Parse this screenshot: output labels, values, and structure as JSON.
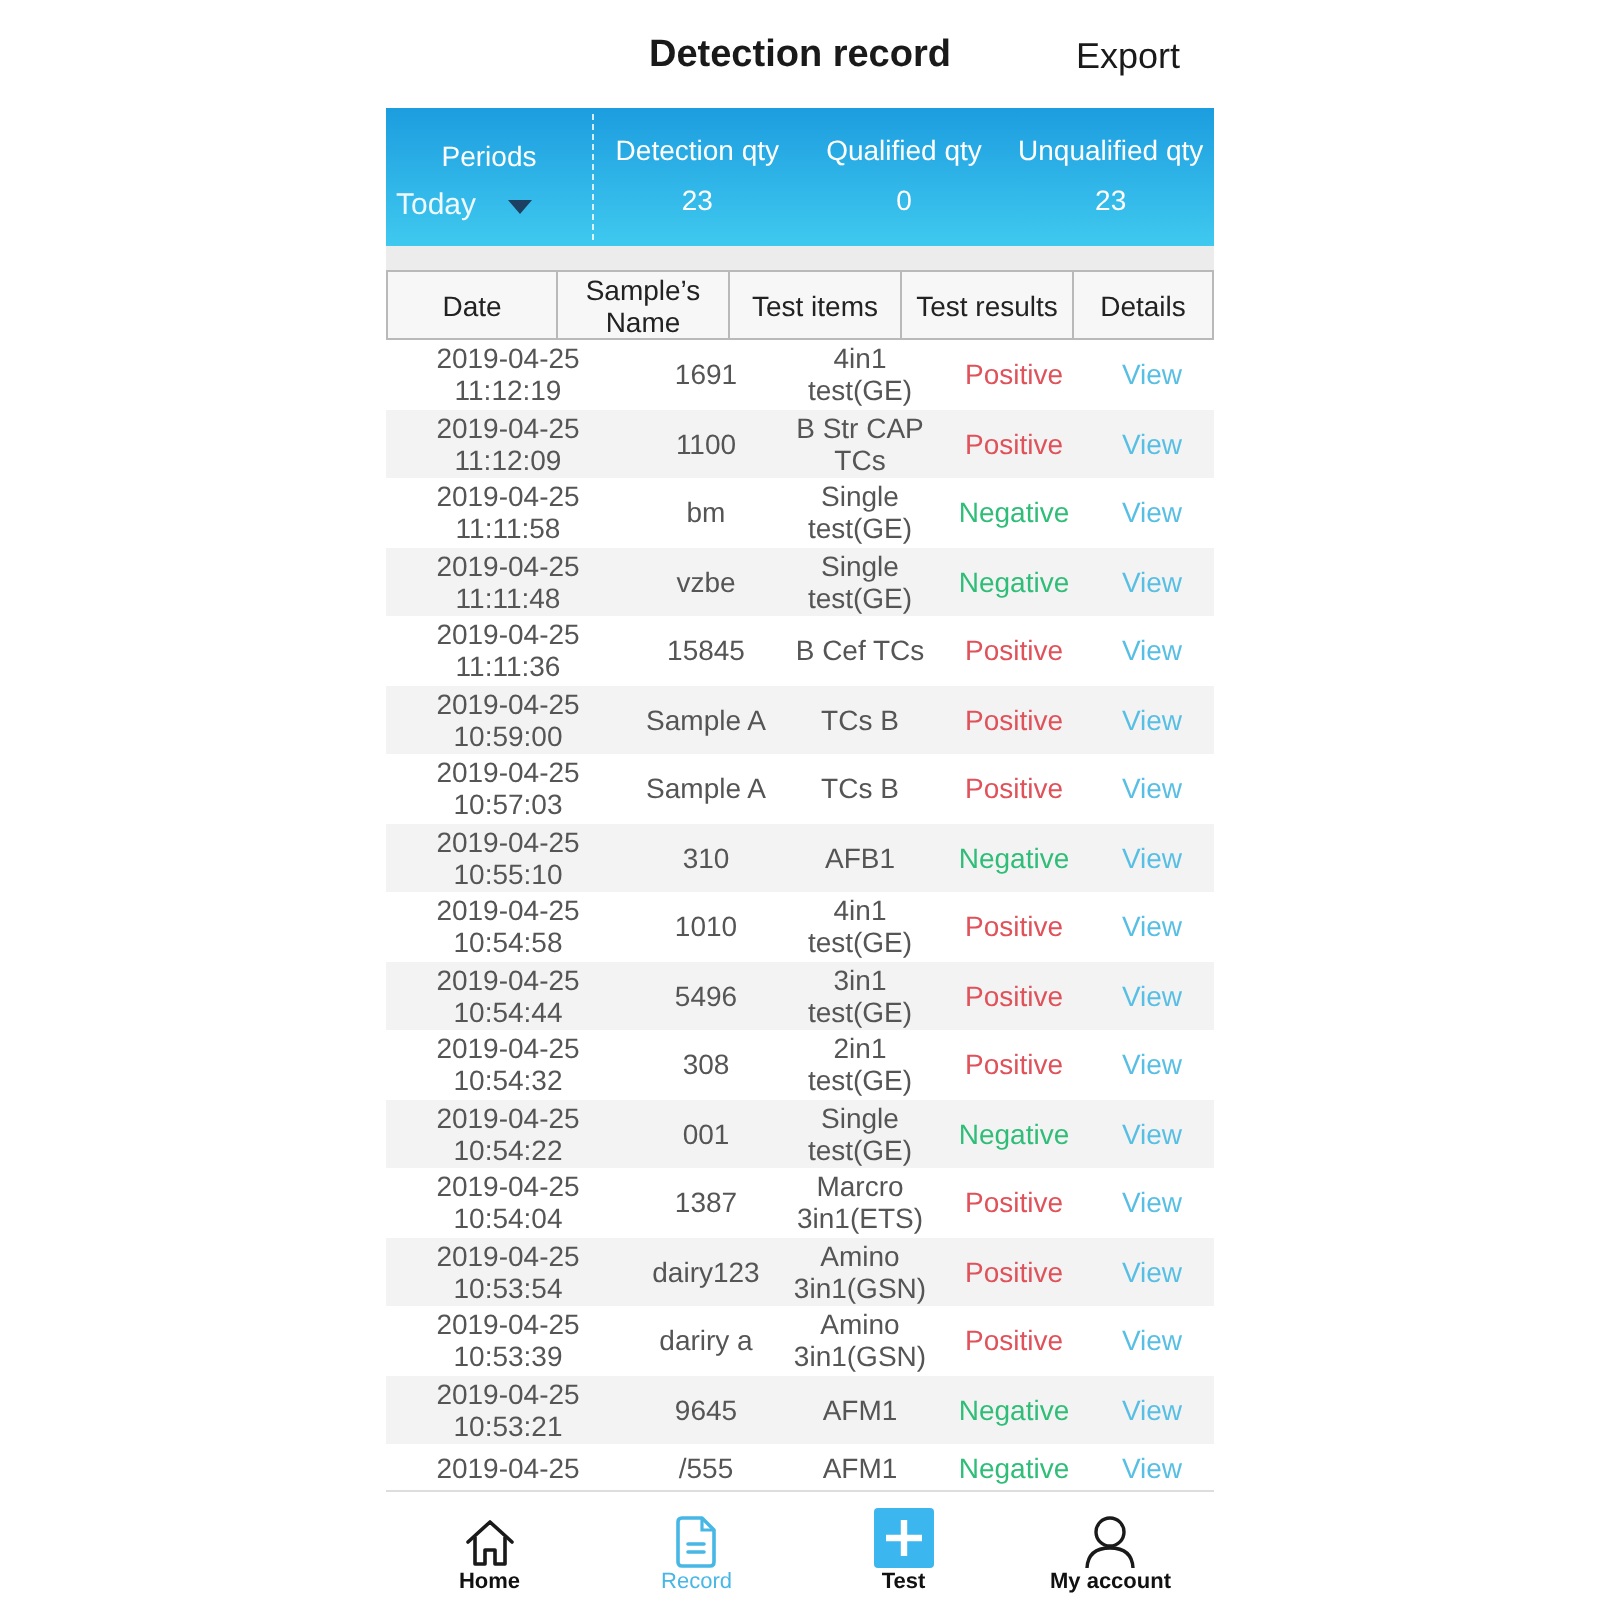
{
  "header": {
    "title": "Detection record",
    "action": "Export"
  },
  "summary": {
    "period_label": "Periods",
    "period_value": "Today",
    "stats": [
      {
        "label": "Detection qty",
        "value": "23"
      },
      {
        "label": "Qualified qty",
        "value": "0"
      },
      {
        "label": "Unqualified qty",
        "value": "23"
      }
    ]
  },
  "table": {
    "columns": [
      "Date",
      "Sample’s Name",
      "Test items",
      "Test results",
      "Details"
    ],
    "rows": [
      {
        "date": "2019-04-25 11:12:19",
        "sample": "1691",
        "item": "4in1 test(GE)",
        "result": "Positive",
        "color": "#e0525a",
        "details": "View"
      },
      {
        "date": "2019-04-25 11:12:09",
        "sample": "1100",
        "item": "B Str CAP TCs",
        "result": "Positive",
        "color": "#e0525a",
        "details": "View"
      },
      {
        "date": "2019-04-25 11:11:58",
        "sample": "bm",
        "item": "Single test(GE)",
        "result": "Negative",
        "color": "#2fbd78",
        "details": "View"
      },
      {
        "date": "2019-04-25 11:11:48",
        "sample": "vzbe",
        "item": "Single test(GE)",
        "result": "Negative",
        "color": "#2fbd78",
        "details": "View"
      },
      {
        "date": "2019-04-25 11:11:36",
        "sample": "15845",
        "item": "B Cef TCs",
        "result": "Positive",
        "color": "#e0525a",
        "details": "View"
      },
      {
        "date": "2019-04-25 10:59:00",
        "sample": "Sample A",
        "item": "TCs B",
        "result": "Positive",
        "color": "#e0525a",
        "details": "View"
      },
      {
        "date": "2019-04-25 10:57:03",
        "sample": "Sample A",
        "item": "TCs B",
        "result": "Positive",
        "color": "#e0525a",
        "details": "View"
      },
      {
        "date": "2019-04-25 10:55:10",
        "sample": "310",
        "item": "AFB1",
        "result": "Negative",
        "color": "#2fbd78",
        "details": "View"
      },
      {
        "date": "2019-04-25 10:54:58",
        "sample": "1010",
        "item": "4in1 test(GE)",
        "result": "Positive",
        "color": "#e0525a",
        "details": "View"
      },
      {
        "date": "2019-04-25 10:54:44",
        "sample": "5496",
        "item": "3in1 test(GE)",
        "result": "Positive",
        "color": "#e0525a",
        "details": "View"
      },
      {
        "date": "2019-04-25 10:54:32",
        "sample": "308",
        "item": "2in1 test(GE)",
        "result": "Positive",
        "color": "#e0525a",
        "details": "View"
      },
      {
        "date": "2019-04-25 10:54:22",
        "sample": "001",
        "item": "Single test(GE)",
        "result": "Negative",
        "color": "#2fbd78",
        "details": "View"
      },
      {
        "date": "2019-04-25 10:54:04",
        "sample": "1387",
        "item": "Marcro 3in1(ETS)",
        "result": "Positive",
        "color": "#e0525a",
        "details": "View"
      },
      {
        "date": "2019-04-25 10:53:54",
        "sample": "dairy123",
        "item": "Amino 3in1(GSN)",
        "result": "Positive",
        "color": "#e0525a",
        "details": "View"
      },
      {
        "date": "2019-04-25 10:53:39",
        "sample": "dariry a",
        "item": "Amino 3in1(GSN)",
        "result": "Positive",
        "color": "#e0525a",
        "details": "View"
      },
      {
        "date": "2019-04-25 10:53:21",
        "sample": "9645",
        "item": "AFM1",
        "result": "Negative",
        "color": "#2fbd78",
        "details": "View"
      },
      {
        "date": "2019-04-25",
        "sample": "/555",
        "item": "AFM1",
        "result": "Negative",
        "color": "#2fbd78",
        "details": "View"
      }
    ]
  },
  "nav": [
    {
      "label": "Home",
      "selected": false
    },
    {
      "label": "Record",
      "selected": true
    },
    {
      "label": "Test",
      "selected": false
    },
    {
      "label": "My account",
      "selected": false
    }
  ]
}
